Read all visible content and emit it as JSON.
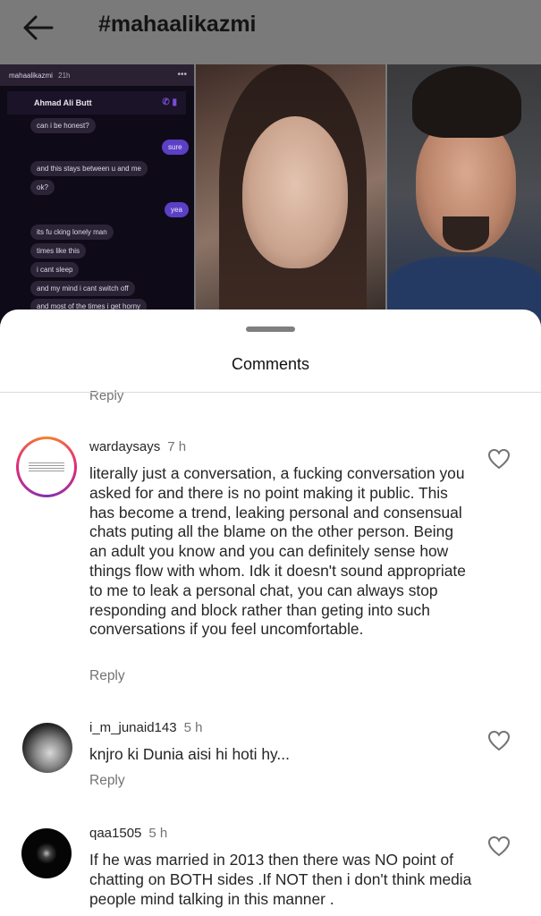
{
  "header": {
    "title": "#mahaalikazmi"
  },
  "post_preview": {
    "account": "mahaalikazmi",
    "age": "21h",
    "chat_contact": "Ahmad Ali Butt",
    "messages": [
      {
        "from": "them",
        "text": "can i be honest?"
      },
      {
        "from": "me",
        "text": "sure"
      },
      {
        "from": "them",
        "text": "and this stays between u and me"
      },
      {
        "from": "them",
        "text": "ok?"
      },
      {
        "from": "me",
        "text": "yea"
      },
      {
        "from": "them",
        "text": "its fu cking lonely man"
      },
      {
        "from": "them",
        "text": "times like this"
      },
      {
        "from": "them",
        "text": "i cant sleep"
      },
      {
        "from": "them",
        "text": "and my mind i cant switch off"
      },
      {
        "from": "them",
        "text": "and most of the times i get horny"
      }
    ]
  },
  "sheet": {
    "title": "Comments",
    "cut_reply": "Reply"
  },
  "comments": [
    {
      "username": "wardaysays",
      "time": "7 h",
      "text": "literally just a conversation, a fucking conversation you asked for and there is no point making it public. This has become a trend, leaking personal and consensual chats puting all the blame on the other person. Being an adult you know and you can definitely sense how things flow with whom. Idk it doesn't sound appropriate to me to leak a personal chat, you can always stop responding and block rather than geting into such conversations if you feel uncomfortable.",
      "reply": "Reply"
    },
    {
      "username": "i_m_junaid143",
      "time": "5 h",
      "text": "knjro ki Dunia aisi hi hoti hy...",
      "reply": "Reply"
    },
    {
      "username": "qaa1505",
      "time": "5 h",
      "text": "If he was married in 2013 then there was NO point of chatting on BOTH sides .If NOT then  i don't think media people mind talking in this manner .",
      "reply": ""
    }
  ],
  "colors": {
    "overlay": "#7a7a7a",
    "secondary_text": "#737373",
    "primary_text": "#262626"
  }
}
